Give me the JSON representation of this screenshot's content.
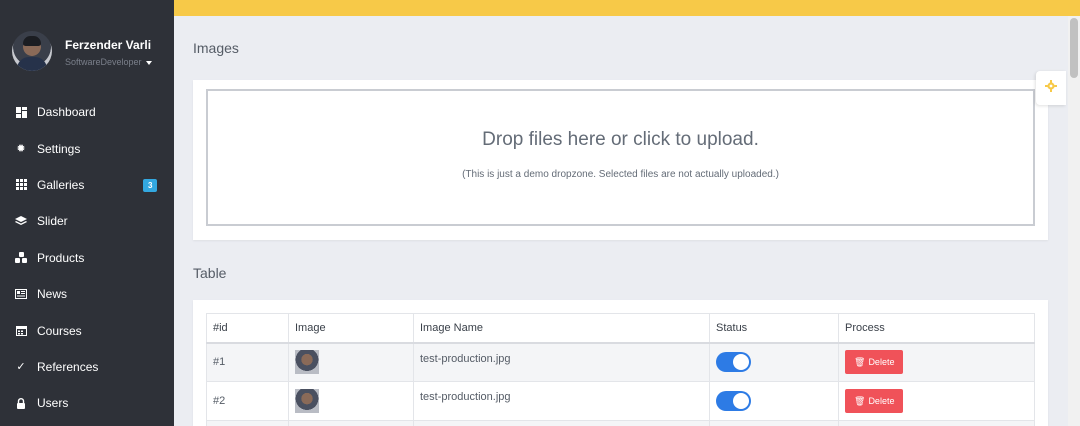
{
  "user": {
    "name": "Ferzender Varli",
    "role": "SoftwareDeveloper"
  },
  "nav": [
    {
      "label": "Dashboard",
      "icon": "dashboard-icon"
    },
    {
      "label": "Settings",
      "icon": "gear-icon"
    },
    {
      "label": "Galleries",
      "icon": "grid-icon",
      "badge": "3"
    },
    {
      "label": "Slider",
      "icon": "layers-icon"
    },
    {
      "label": "Products",
      "icon": "cubes-icon"
    },
    {
      "label": "News",
      "icon": "newspaper-icon"
    },
    {
      "label": "Courses",
      "icon": "calendar-icon"
    },
    {
      "label": "References",
      "icon": "check-icon"
    },
    {
      "label": "Users",
      "icon": "user-lock-icon"
    }
  ],
  "images_section": {
    "title": "Images",
    "dropzone_message": "Drop files here or click to upload.",
    "dropzone_note": "(This is just a demo dropzone. Selected files are not actually uploaded.)"
  },
  "table_section": {
    "title": "Table",
    "headers": [
      "#id",
      "Image",
      "Image Name",
      "Status",
      "Process"
    ],
    "rows": [
      {
        "id": "#1",
        "image_name": "test-production.jpg",
        "status_on": true,
        "action": "Delete"
      },
      {
        "id": "#2",
        "image_name": "test-production.jpg",
        "status_on": true,
        "action": "Delete"
      }
    ]
  },
  "colors": {
    "topbar": "#f7c948",
    "sidebar": "#2e3138",
    "badge": "#33a8e0",
    "toggle": "#2d7be5",
    "delete": "#f05259",
    "gear": "#f7c948"
  }
}
